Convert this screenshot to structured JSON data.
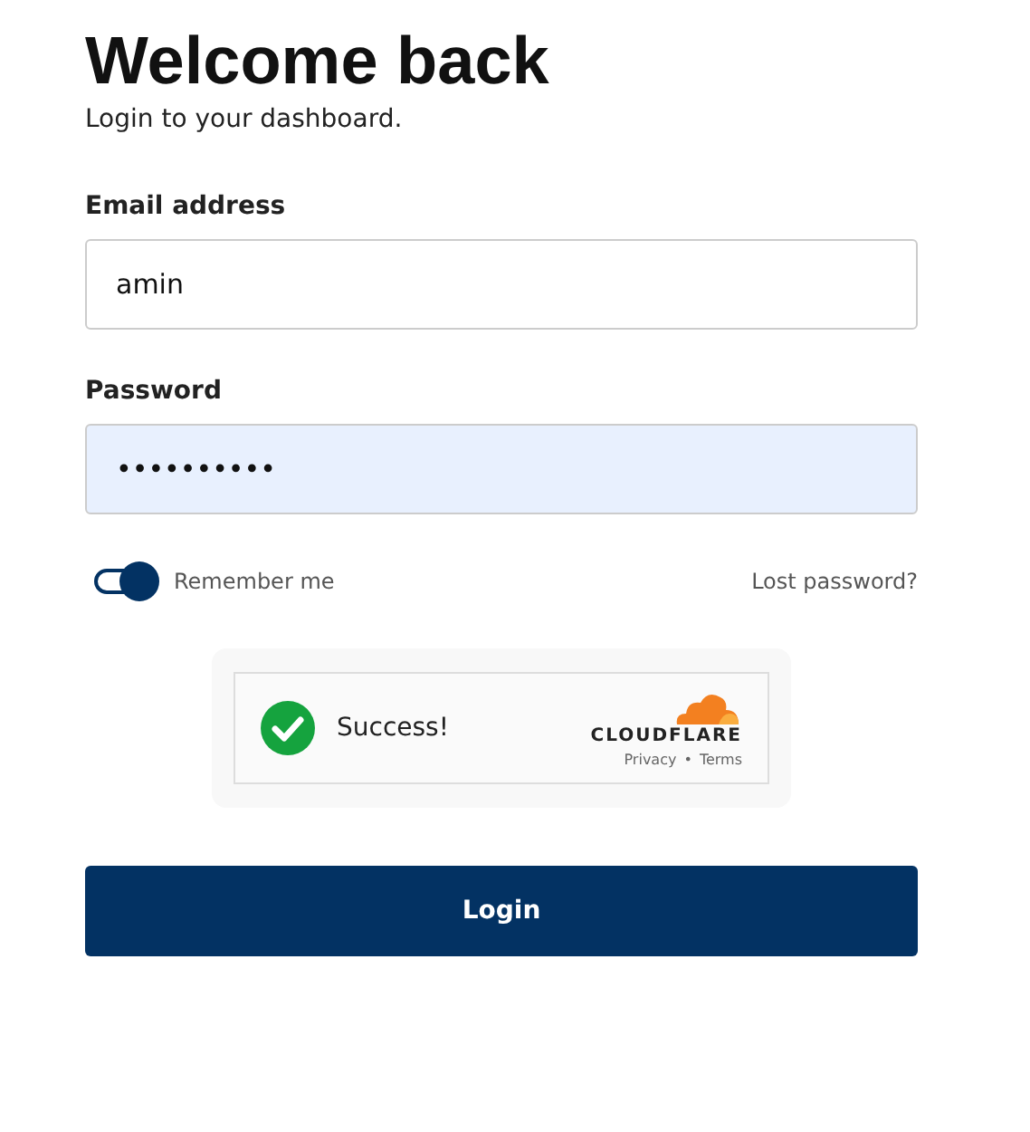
{
  "title": "Welcome back",
  "subtitle": "Login to your dashboard.",
  "fields": [
    {
      "label": "Email address",
      "value": "amin",
      "autofilled": false
    },
    {
      "label": "Password",
      "value": "••••••••••",
      "autofilled": true
    }
  ],
  "remember": {
    "label": "Remember me",
    "on": true
  },
  "lost_password": "Lost password?",
  "captcha": {
    "status": "Success!",
    "brand": "CLOUDFLARE",
    "links": [
      "Privacy",
      "Terms"
    ],
    "separator": "•"
  },
  "button": "Login"
}
